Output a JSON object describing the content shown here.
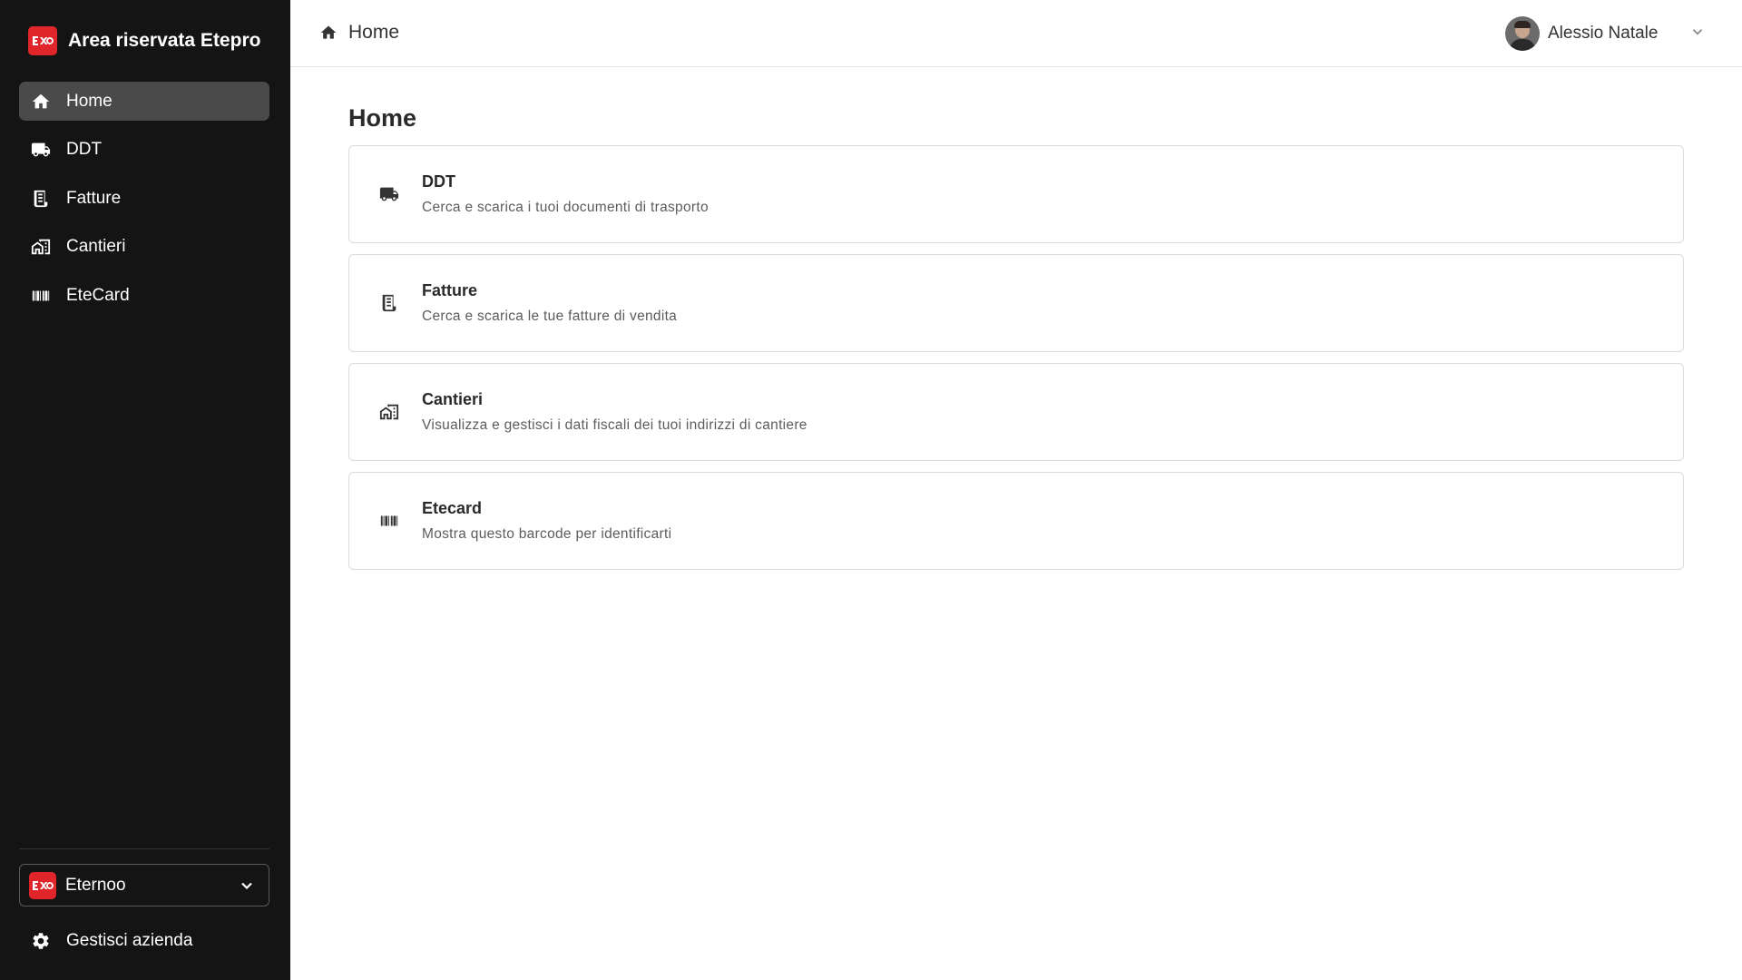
{
  "app": {
    "title": "Area riservata Etepro"
  },
  "sidebar": {
    "items": [
      {
        "label": "Home",
        "icon": "home-icon",
        "active": true
      },
      {
        "label": "DDT",
        "icon": "truck-icon",
        "active": false
      },
      {
        "label": "Fatture",
        "icon": "receipt-icon",
        "active": false
      },
      {
        "label": "Cantieri",
        "icon": "buildings-icon",
        "active": false
      },
      {
        "label": "EteCard",
        "icon": "barcode-icon",
        "active": false
      }
    ],
    "company": {
      "name": "Eternoo"
    },
    "manage_label": "Gestisci azienda"
  },
  "header": {
    "breadcrumb": "Home",
    "user_name": "Alessio Natale"
  },
  "main": {
    "title": "Home",
    "cards": [
      {
        "title": "DDT",
        "description": "Cerca e scarica i tuoi documenti di trasporto",
        "icon": "truck-icon"
      },
      {
        "title": "Fatture",
        "description": "Cerca e scarica le tue fatture di vendita",
        "icon": "receipt-icon"
      },
      {
        "title": "Cantieri",
        "description": "Visualizza e gestisci i dati fiscali dei tuoi indirizzi di cantiere",
        "icon": "buildings-icon"
      },
      {
        "title": "Etecard",
        "description": "Mostra questo barcode per identificarti",
        "icon": "barcode-icon"
      }
    ]
  },
  "colors": {
    "sidebar_bg": "#141414",
    "active_item_bg": "#4a4a4a",
    "brand_red": "#e0262b",
    "card_border": "#dcdcdc"
  }
}
